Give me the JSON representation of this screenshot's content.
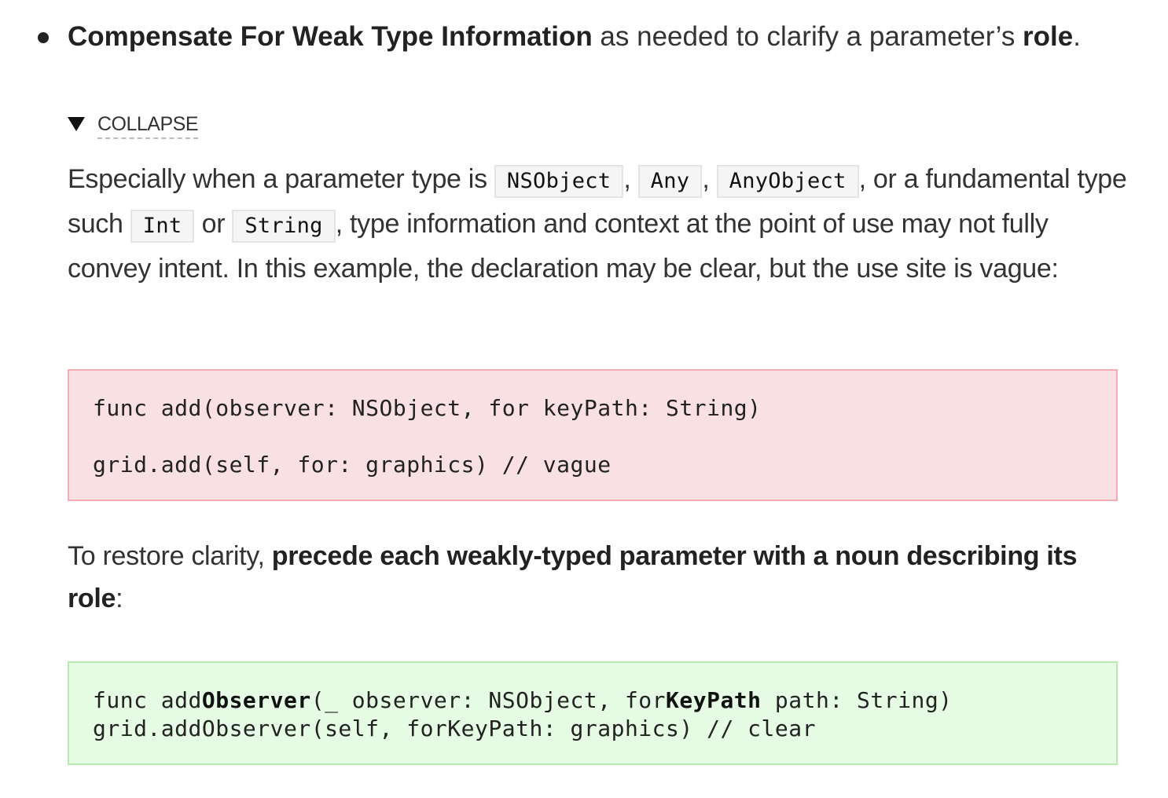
{
  "heading": {
    "bold_title": "Compensate For Weak Type Information",
    "middle_text": " as needed to clarify a parameter’s ",
    "bold_role": "role",
    "end": "."
  },
  "collapse": {
    "label": "COLLAPSE"
  },
  "paragraph1": {
    "t1": "Especially when a parameter type is ",
    "c1": "NSObject",
    "t2": ", ",
    "c2": "Any",
    "t3": ", ",
    "c3": "AnyObject",
    "t4": ", or a fundamental type such ",
    "c4": "Int",
    "t5": " or ",
    "c5": "String",
    "t6": ", type information and context at the point of use may not fully convey intent. In this example, the declaration may be clear, but the use site is vague:"
  },
  "bad_example": {
    "line1": "func add(observer: NSObject, for keyPath: String)",
    "line2": "grid.add(self, for: graphics) // vague"
  },
  "paragraph2": {
    "t1": "To restore clarity, ",
    "bold": "precede each weakly-typed parameter with a noun describing its role",
    "t2": ":"
  },
  "good_example": {
    "l1_a": "func add",
    "l1_b": "Observer",
    "l1_c": "(_ observer: NSObject, for",
    "l1_d": "KeyPath",
    "l1_e": " path: String)",
    "line2": "grid.addObserver(self, forKeyPath: graphics) // clear"
  },
  "colors": {
    "bad_bg": "#f9e0e2",
    "bad_border": "#f3aab2",
    "good_bg": "#e5fbe3",
    "good_border": "#b7eab2",
    "inline_code_bg": "#f5f5f5"
  }
}
